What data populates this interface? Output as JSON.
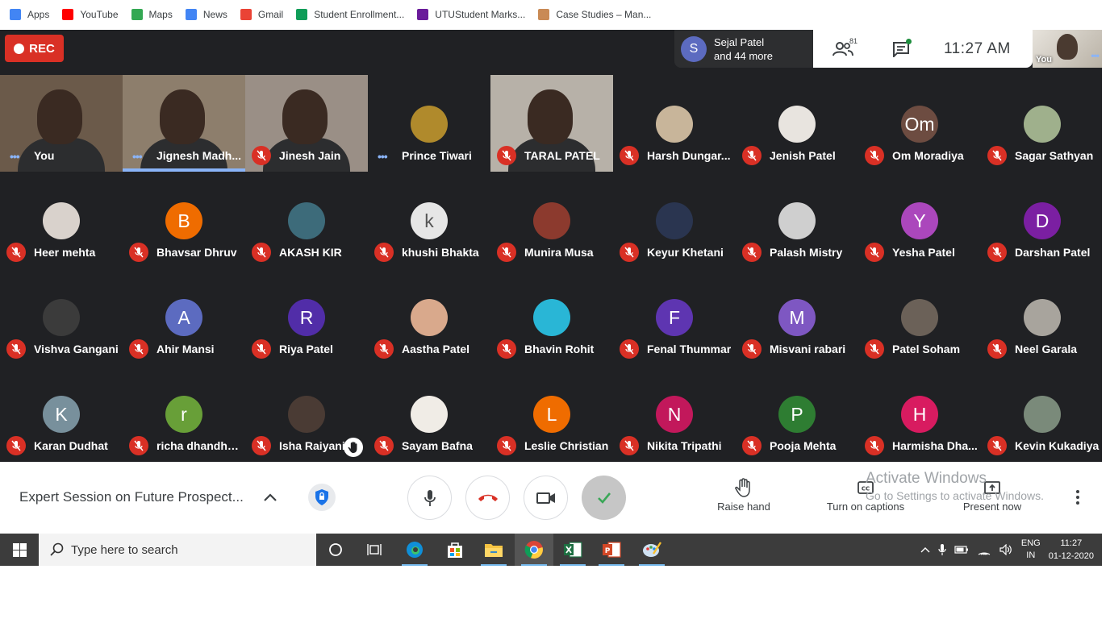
{
  "bookmarks": [
    {
      "label": "Apps",
      "icon": "apps-grid-icon",
      "color": "#4285f4"
    },
    {
      "label": "YouTube",
      "icon": "youtube-icon",
      "color": "#ff0000"
    },
    {
      "label": "Maps",
      "icon": "maps-icon",
      "color": "#34a853"
    },
    {
      "label": "News",
      "icon": "news-icon",
      "color": "#4285f4"
    },
    {
      "label": "Gmail",
      "icon": "gmail-icon",
      "color": "#ea4335"
    },
    {
      "label": "Student Enrollment...",
      "icon": "sheets-icon",
      "color": "#0f9d58"
    },
    {
      "label": "UTUStudent Marks...",
      "icon": "utu-icon",
      "color": "#6a1b9a"
    },
    {
      "label": "Case Studies – Man...",
      "icon": "case-studies-icon",
      "color": "#c98a55"
    }
  ],
  "meet": {
    "rec_label": "REC",
    "presenter": {
      "initial": "S",
      "name": "Sejal Patel",
      "more": "and 44 more"
    },
    "people_count": "81",
    "time": "11:27  AM",
    "self_label": "You",
    "participants": [
      {
        "name": "You",
        "status": "speaking",
        "type": "video",
        "bg": "#6b5a4a"
      },
      {
        "name": "Jignesh Madh...",
        "status": "speaking",
        "type": "video",
        "bg": "#8d7e6c",
        "active": true
      },
      {
        "name": "Jinesh Jain",
        "status": "muted",
        "type": "video",
        "bg": "#9a8f86"
      },
      {
        "name": "Prince Tiwari",
        "status": "speaking",
        "type": "photo",
        "bg": "#b08a2c"
      },
      {
        "name": "TARAL PATEL",
        "status": "muted",
        "type": "video",
        "bg": "#b7b1a8"
      },
      {
        "name": "Harsh Dungar...",
        "status": "muted",
        "type": "photo",
        "bg": "#c8b59a"
      },
      {
        "name": "Jenish Patel",
        "status": "muted",
        "type": "photo",
        "bg": "#e8e4df"
      },
      {
        "name": "Om Moradiya",
        "status": "muted",
        "type": "initial",
        "initial": "Om",
        "bg": "#6d4c41"
      },
      {
        "name": "Sagar Sathyan",
        "status": "muted",
        "type": "photo",
        "bg": "#9fb08c"
      },
      {
        "name": "Heer mehta",
        "status": "muted",
        "type": "photo",
        "bg": "#d9d2cc"
      },
      {
        "name": "Bhavsar Dhruv",
        "status": "muted",
        "type": "initial",
        "initial": "B",
        "bg": "#ef6c00"
      },
      {
        "name": "AKASH KIR",
        "status": "muted",
        "type": "photo",
        "bg": "#3d6b7a"
      },
      {
        "name": "khushi Bhakta",
        "status": "muted",
        "type": "initial",
        "initial": "k",
        "bg": "#e6e6e6",
        "fg": "#555555"
      },
      {
        "name": "Munira Musa",
        "status": "muted",
        "type": "photo",
        "bg": "#8c3a2e"
      },
      {
        "name": "Keyur Khetani",
        "status": "muted",
        "type": "photo",
        "bg": "#2a3550"
      },
      {
        "name": "Palash Mistry",
        "status": "muted",
        "type": "photo",
        "bg": "#cfcfcf"
      },
      {
        "name": "Yesha Patel",
        "status": "muted",
        "type": "initial",
        "initial": "Y",
        "bg": "#ab47bc"
      },
      {
        "name": "Darshan Patel",
        "status": "muted",
        "type": "initial",
        "initial": "D",
        "bg": "#7b1fa2"
      },
      {
        "name": "Vishva Gangani",
        "status": "muted",
        "type": "photo",
        "bg": "#3b3b3b"
      },
      {
        "name": "Ahir Mansi",
        "status": "muted",
        "type": "initial",
        "initial": "A",
        "bg": "#5c6bc0"
      },
      {
        "name": "Riya Patel",
        "status": "muted",
        "type": "initial",
        "initial": "R",
        "bg": "#512da8"
      },
      {
        "name": "Aastha Patel",
        "status": "muted",
        "type": "photo",
        "bg": "#d9a98c"
      },
      {
        "name": "Bhavin Rohit",
        "status": "muted",
        "type": "photo",
        "bg": "#29b6d6"
      },
      {
        "name": "Fenal Thummar",
        "status": "muted",
        "type": "initial",
        "initial": "F",
        "bg": "#5e35b1"
      },
      {
        "name": "Misvani rabari",
        "status": "muted",
        "type": "initial",
        "initial": "M",
        "bg": "#7e57c2"
      },
      {
        "name": "Patel Soham",
        "status": "muted",
        "type": "photo",
        "bg": "#6b6158"
      },
      {
        "name": "Neel Garala",
        "status": "muted",
        "type": "photo",
        "bg": "#a8a49d"
      },
      {
        "name": "Karan Dudhat",
        "status": "muted",
        "type": "initial",
        "initial": "K",
        "bg": "#78909c"
      },
      {
        "name": "richa dhandhu...",
        "status": "muted",
        "type": "initial",
        "initial": "r",
        "bg": "#689f38"
      },
      {
        "name": "Isha Raiyani",
        "status": "muted",
        "type": "photo",
        "bg": "#4a3b34",
        "hand": true
      },
      {
        "name": "Sayam Bafna",
        "status": "muted",
        "type": "photo",
        "bg": "#f0ece6"
      },
      {
        "name": "Leslie Christian",
        "status": "muted",
        "type": "initial",
        "initial": "L",
        "bg": "#ef6c00"
      },
      {
        "name": "Nikita Tripathi",
        "status": "muted",
        "type": "initial",
        "initial": "N",
        "bg": "#c2185b"
      },
      {
        "name": "Pooja Mehta",
        "status": "muted",
        "type": "initial",
        "initial": "P",
        "bg": "#2e7d32"
      },
      {
        "name": "Harmisha Dha...",
        "status": "muted",
        "type": "initial",
        "initial": "H",
        "bg": "#d81b60"
      },
      {
        "name": "Kevin Kukadiya",
        "status": "muted",
        "type": "photo",
        "bg": "#7a8a7a"
      }
    ]
  },
  "controls": {
    "meeting_title": "Expert Session on Future Prospect...",
    "raise_hand": "Raise hand",
    "captions": "Turn on captions",
    "present": "Present now"
  },
  "watermark": {
    "line1": "Activate Windows",
    "line2": "Go to Settings to activate Windows."
  },
  "taskbar": {
    "search_placeholder": "Type here to search",
    "lang_top": "ENG",
    "lang_bottom": "IN",
    "time": "11:27",
    "date": "01-12-2020"
  }
}
